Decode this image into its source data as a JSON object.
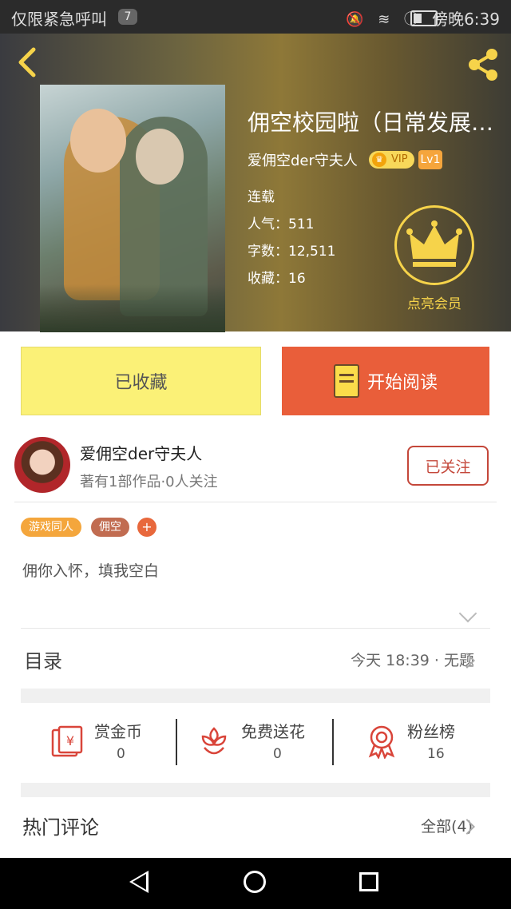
{
  "status_bar": {
    "carrier": "仅限紧急呼叫",
    "notification_count": "7",
    "time": "傍晚6:39"
  },
  "book": {
    "title": "佣空校园啦（日常发展超…",
    "author": "爱佣空der守夫人",
    "vip_label": "VIP",
    "level": "Lv1",
    "status": "连载",
    "popularity": "人气：511",
    "word_count": "字数：12,511",
    "favorites": "收藏：16",
    "member_label": "点亮会员"
  },
  "actions": {
    "favorited_label": "已收藏",
    "read_label": "开始阅读"
  },
  "author_card": {
    "name": "爱佣空der守夫人",
    "info": "著有1部作品·0人关注",
    "follow_label": "已关注"
  },
  "tags": [
    "游戏同人",
    "佣空"
  ],
  "tag_add": "+",
  "intro": "佣你入怀，填我空白",
  "catalog": {
    "label": "目录",
    "latest": "今天 18:39 · 无题"
  },
  "stats": [
    {
      "label": "赏金币",
      "value": "0",
      "icon": "red-envelope-icon"
    },
    {
      "label": "免费送花",
      "value": "0",
      "icon": "flower-icon"
    },
    {
      "label": "粉丝榜",
      "value": "16",
      "icon": "medal-icon"
    }
  ],
  "comments": {
    "label": "热门评论",
    "all": "全部(4)"
  },
  "colors": {
    "accent_orange": "#e95e3a",
    "fav_yellow": "#fbf177",
    "crown_gold": "#f6d34a",
    "follow_red": "#c4473a"
  }
}
